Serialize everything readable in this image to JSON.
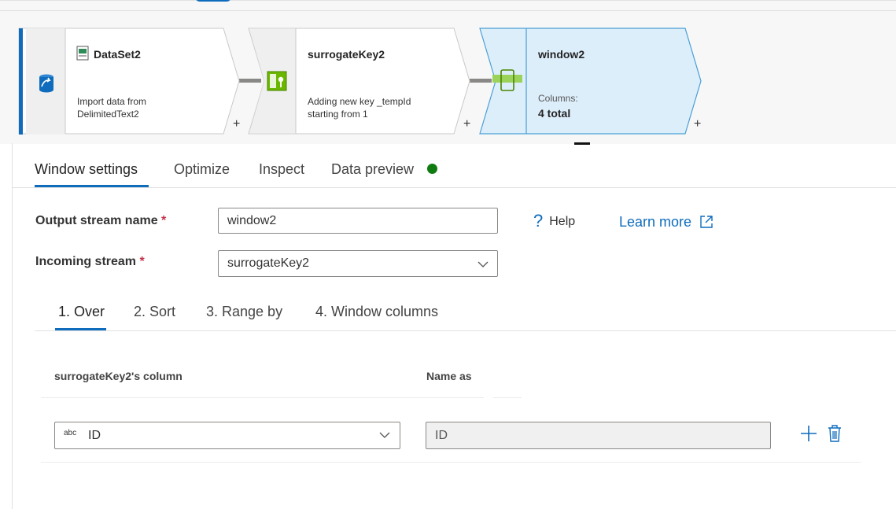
{
  "flow": {
    "nodes": [
      {
        "title": "DataSet2",
        "desc_line1": "Import data from",
        "desc_line2": "DelimitedText2",
        "add": "+"
      },
      {
        "title": "surrogateKey2",
        "desc_line1": "Adding new key _tempId",
        "desc_line2": "starting from 1",
        "add": "+"
      },
      {
        "title": "window2",
        "desc_line1": "Columns:",
        "desc_line2": "4 total",
        "add": "+"
      }
    ]
  },
  "tabs": {
    "items": [
      "Window settings",
      "Optimize",
      "Inspect",
      "Data preview"
    ],
    "active": "Window settings",
    "status_color": "#107c10"
  },
  "form": {
    "output_label": "Output stream name",
    "incoming_label": "Incoming stream",
    "required_mark": "*",
    "output_value": "window2",
    "incoming_value": "surrogateKey2",
    "help_label": "Help",
    "learn_more": "Learn more"
  },
  "subtabs": {
    "items": [
      "1. Over",
      "2. Sort",
      "3. Range by",
      "4. Window columns"
    ],
    "active": "1. Over"
  },
  "over": {
    "col_header": "surrogateKey2's column",
    "name_header": "Name as",
    "rows": [
      {
        "type": "abc",
        "column": "ID",
        "name_as": "ID"
      }
    ]
  },
  "colors": {
    "accent": "#0f6cbd",
    "selected_node": "#ddeefb",
    "selected_border": "#4a9fd6"
  }
}
